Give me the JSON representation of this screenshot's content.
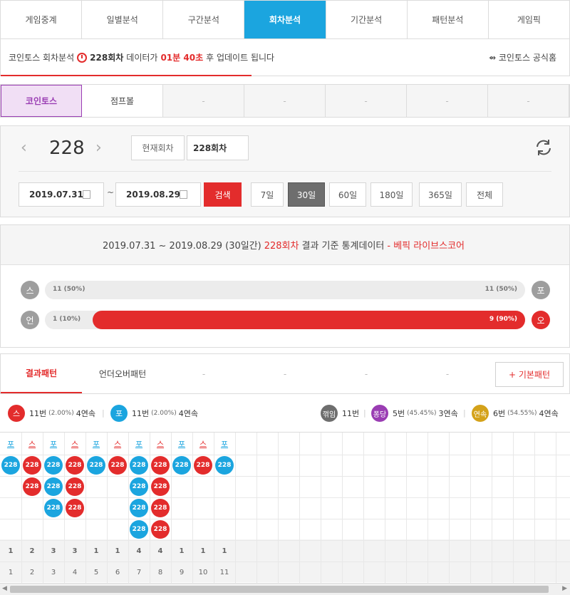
{
  "nav": {
    "tabs": [
      "게임중계",
      "일별분석",
      "구간분석",
      "회차분석",
      "기간분석",
      "패턴분석",
      "게임픽"
    ],
    "active": 3
  },
  "info": {
    "game": "코인토스 회차분석",
    "round": "228회차",
    "text_a": "데이터가",
    "countdown": "01분 40초",
    "text_b": "후 업데이트 됩니다",
    "home_link": "코인토스 공식홈",
    "progress_percent": 44
  },
  "game_tabs": [
    "코인토스",
    "점프볼",
    "-",
    "-",
    "-",
    "-",
    "-"
  ],
  "round_panel": {
    "round": "228",
    "current_button": "현재회차",
    "round_input": "228회차",
    "date_from": "2019.07.31",
    "date_to": "2019.08.29",
    "tilde": "~",
    "search_button": "검색",
    "periods": [
      "7일",
      "30일",
      "60일",
      "180일",
      "365일",
      "전체"
    ],
    "active_period": 1
  },
  "stats": {
    "range": "2019.07.31 ~ 2019.08.29 (30일간)",
    "round": "228회차",
    "suffix": "결과 기준 통계데이터",
    "source": "- 베픽 라이브스코어",
    "rows": [
      {
        "left_label": "스",
        "right_label": "포",
        "left_value": "11 (50%)",
        "right_value": "11 (50%)",
        "right_fraction": 0.5,
        "highlight": false
      },
      {
        "left_label": "언",
        "right_label": "오",
        "left_value": "1 (10%)",
        "right_value": "9 (90%)",
        "right_fraction": 0.9,
        "highlight": true
      }
    ]
  },
  "pattern_tabs": {
    "tabs": [
      "결과패턴",
      "언더오버패턴",
      "-",
      "-",
      "-",
      "-"
    ],
    "basic_button": "+ 기본패턴"
  },
  "summary": {
    "s": {
      "label": "스",
      "count": "11번",
      "pct": "(2.00%)",
      "streak": "4연속"
    },
    "p": {
      "label": "포",
      "count": "11번",
      "pct": "(2.00%)",
      "streak": "4연속"
    },
    "break": {
      "label": "꺾임",
      "count": "11번"
    },
    "pong": {
      "label": "퐁당",
      "count": "5번",
      "pct": "(45.45%)",
      "streak": "3연속"
    },
    "yeon": {
      "label": "연속",
      "count": "6번",
      "pct": "(54.55%)",
      "streak": "4연속"
    }
  },
  "colors": {
    "red": "#e32c2c",
    "blue": "#1ba5df",
    "purple": "#9a3db3",
    "gold": "#d4a21a",
    "gray": "#6e6e6e"
  },
  "grid": {
    "ball_label": "228",
    "columns": [
      {
        "head": "포",
        "side": "p",
        "run": 1,
        "streak": "1",
        "index": "1"
      },
      {
        "head": "스",
        "side": "s",
        "run": 2,
        "streak": "2",
        "index": "2"
      },
      {
        "head": "포",
        "side": "p",
        "run": 3,
        "streak": "3",
        "index": "3"
      },
      {
        "head": "스",
        "side": "s",
        "run": 3,
        "streak": "3",
        "index": "4"
      },
      {
        "head": "포",
        "side": "p",
        "run": 1,
        "streak": "1",
        "index": "5"
      },
      {
        "head": "스",
        "side": "s",
        "run": 1,
        "streak": "1",
        "index": "6"
      },
      {
        "head": "포",
        "side": "p",
        "run": 4,
        "streak": "4",
        "index": "7"
      },
      {
        "head": "스",
        "side": "s",
        "run": 4,
        "streak": "4",
        "index": "8"
      },
      {
        "head": "포",
        "side": "p",
        "run": 1,
        "streak": "1",
        "index": "9"
      },
      {
        "head": "스",
        "side": "s",
        "run": 1,
        "streak": "1",
        "index": "10"
      },
      {
        "head": "포",
        "side": "p",
        "run": 1,
        "streak": "1",
        "index": "11"
      }
    ]
  }
}
